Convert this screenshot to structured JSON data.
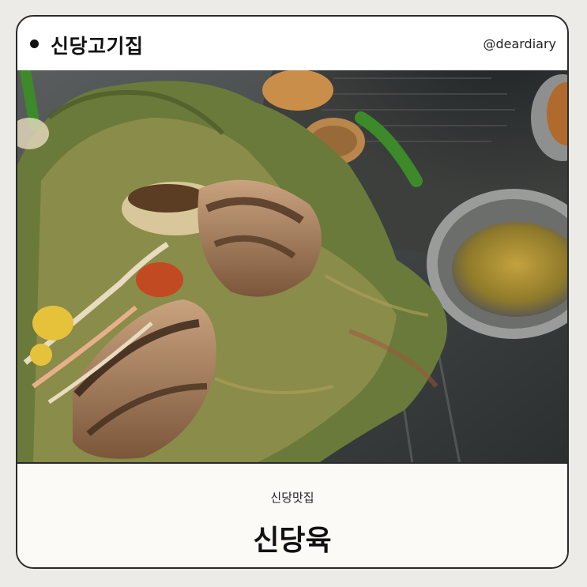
{
  "header": {
    "title": "신당고기집",
    "handle": "@deardiary"
  },
  "footer": {
    "subtitle": "신당맛집",
    "title": "신당육"
  }
}
